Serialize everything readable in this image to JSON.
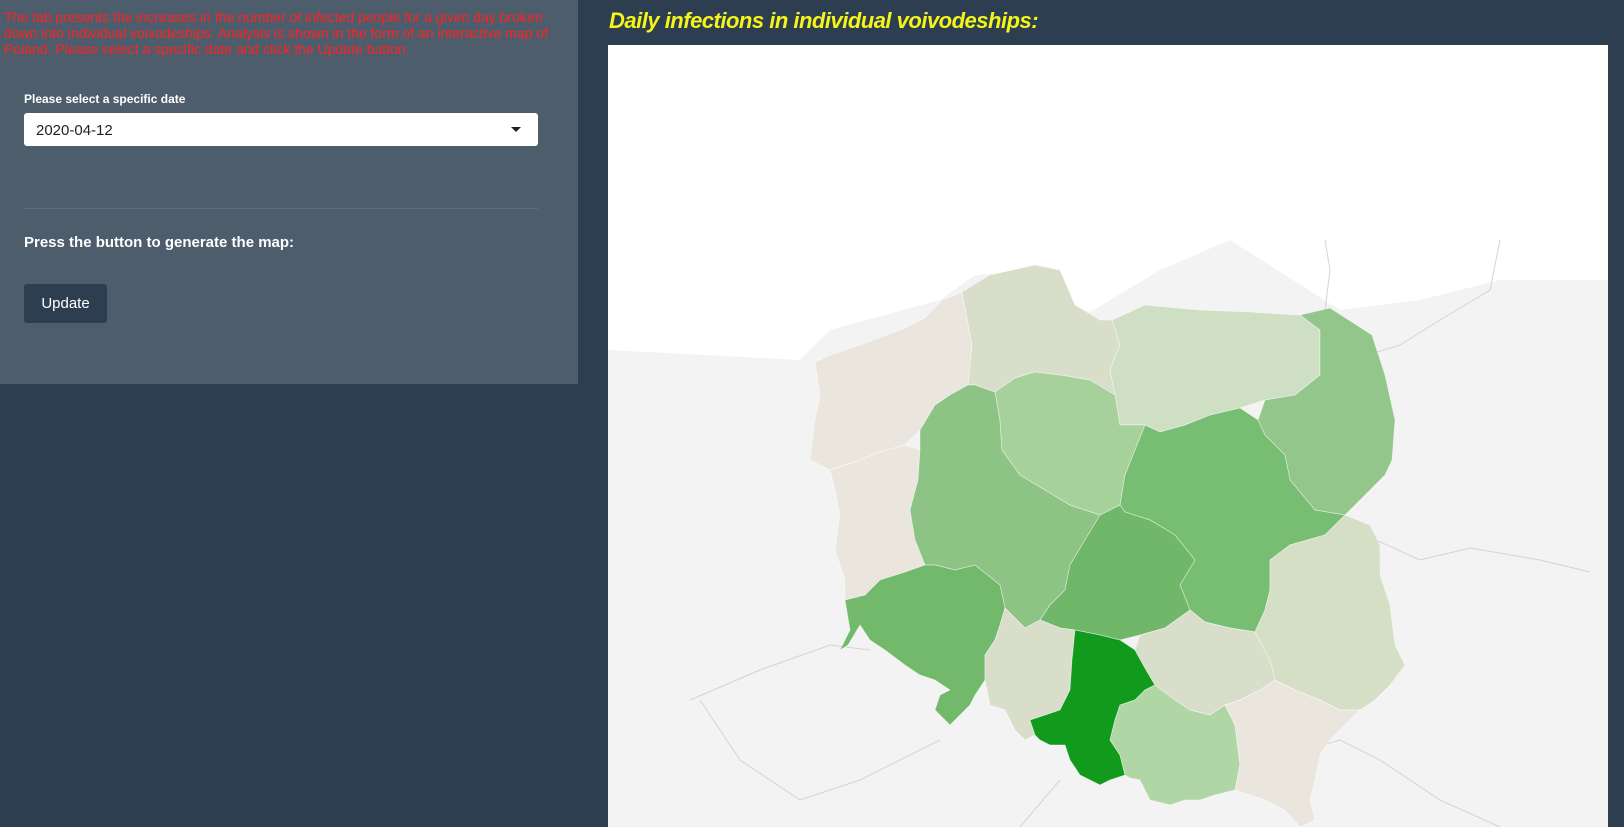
{
  "sidebar": {
    "description": "The tab presents the increases in the number of infected people for a given day broken down into individual voivodeships. Analysis is shown in the form of an interactive map of Poland. Please select a specific date and click the Update button.",
    "date_label": "Please select a specific date",
    "date_value": "2020-04-12",
    "press_label": "Press the button to generate the map:",
    "update_label": "Update"
  },
  "main": {
    "title": "Daily infections in individual voivodeships:"
  },
  "map": {
    "regions": [
      {
        "name": "zachodniopomorskie",
        "color": "#ebe6dd"
      },
      {
        "name": "pomorskie",
        "color": "#d8dec9"
      },
      {
        "name": "warminsko-mazurskie",
        "color": "#cfdfc3"
      },
      {
        "name": "podlaskie",
        "color": "#93c68a"
      },
      {
        "name": "lubuskie",
        "color": "#ebe6dd"
      },
      {
        "name": "wielkopolskie",
        "color": "#8dc485"
      },
      {
        "name": "kujawsko-pomorskie",
        "color": "#a6d19b"
      },
      {
        "name": "mazowieckie",
        "color": "#78be72"
      },
      {
        "name": "lodzkie",
        "color": "#70b769"
      },
      {
        "name": "lubelskie",
        "color": "#d4dfc6"
      },
      {
        "name": "dolnoslaskie",
        "color": "#72b96b"
      },
      {
        "name": "opolskie",
        "color": "#d8dec9"
      },
      {
        "name": "slaskie",
        "color": "#119a1c"
      },
      {
        "name": "swietokrzyskie",
        "color": "#d8dec9"
      },
      {
        "name": "malopolskie",
        "color": "#b1d6a6"
      },
      {
        "name": "podkarpackie",
        "color": "#ebe6dd"
      }
    ]
  }
}
